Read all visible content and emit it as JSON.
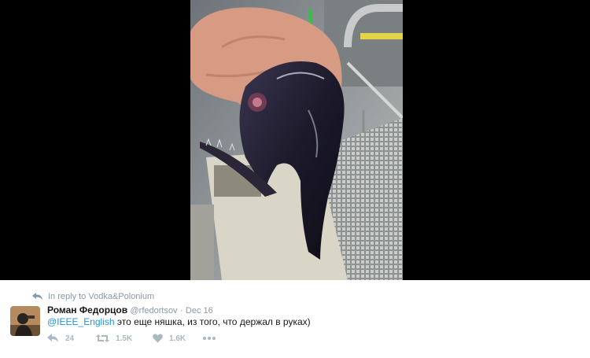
{
  "reply_context": {
    "prefix": "In reply to",
    "target": "Vodka&Polonium"
  },
  "author": {
    "name": "Роман Федорцов",
    "handle": "@rfedortsov"
  },
  "date": "Dec 16",
  "separator": "·",
  "tweet": {
    "mention": "@IEEE_English",
    "text": "это еще няшка, из того, что держал в руках)"
  },
  "stats": {
    "replies": "24",
    "retweets": "1.5K",
    "likes": "1.6K"
  },
  "colors": {
    "link": "#1b95e0",
    "muted": "#8899a6",
    "icon": "#aab8c2"
  }
}
